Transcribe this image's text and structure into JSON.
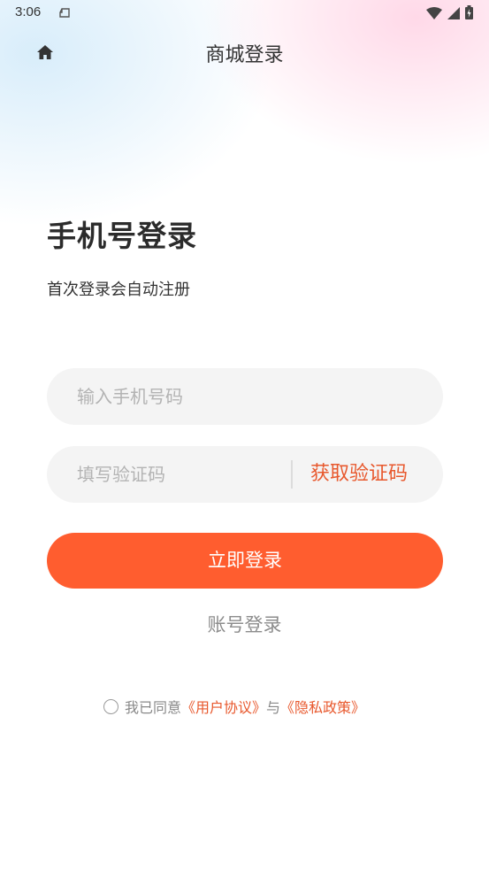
{
  "status_bar": {
    "time": "3:06",
    "icons": [
      "notification-icon",
      "wifi-icon",
      "cellular-signal-icon",
      "battery-charging-icon"
    ]
  },
  "nav": {
    "home_icon": "home-icon",
    "title": "商城登录"
  },
  "login": {
    "heading": "手机号登录",
    "subheading": "首次登录会自动注册",
    "phone_placeholder": "输入手机号码",
    "code_placeholder": "填写验证码",
    "get_code_label": "获取验证码",
    "submit_label": "立即登录",
    "account_login_label": "账号登录"
  },
  "agreement": {
    "checked": false,
    "prefix": "我已同意",
    "user_agreement": "《用户协议》",
    "conjunction": "与",
    "privacy_policy": "《隐私政策》"
  },
  "colors": {
    "accent": "#ff5d2f",
    "link": "#e8582d",
    "input_bg": "#f4f4f4"
  }
}
